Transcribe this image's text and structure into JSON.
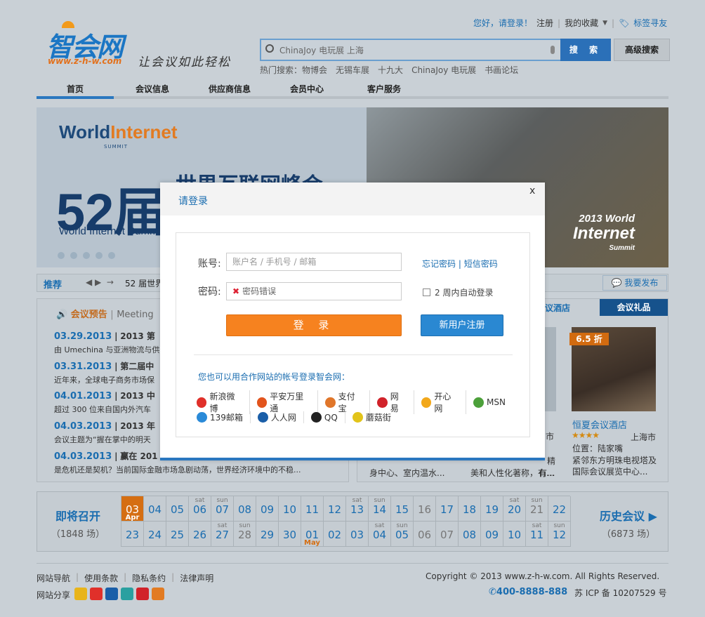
{
  "header": {
    "logo_text": "智会网",
    "logo_url": "www.z-h-w.com",
    "slogan": "让会议如此轻松",
    "greeting": "您好，请登录！",
    "register": "注册",
    "favorites": "我的收藏",
    "bookmark": "标签寻友"
  },
  "search": {
    "placeholder": "ChinaJoy 电玩展 上海",
    "button": "搜 索",
    "advanced": "高级搜索",
    "hot_label": "热门搜索：",
    "hot_items": [
      "物博会",
      "无锡车展",
      "十九大",
      "ChinaJoy 电玩展",
      "书画论坛"
    ]
  },
  "nav": {
    "items": [
      "首页",
      "会议信息",
      "供应商信息",
      "会员中心",
      "客户服务"
    ]
  },
  "banner": {
    "brand_world": "World",
    "brand_internet": "Internet",
    "brand_summit": "SUMMIT",
    "number": "52届",
    "title": "世界互联网峰会",
    "subtitle": "World Internet Summit",
    "corner_line1": "2013 World",
    "corner_line2": "Internet",
    "corner_line3": "Summit"
  },
  "recommend": {
    "label": "推荐",
    "text": "52 届世界",
    "publish": "我要发布"
  },
  "preview": {
    "title": "会议预告",
    "meeting": "Meeting",
    "items": [
      {
        "date": "03.29.2013",
        "title": "2013 第",
        "summary": "由 Umechina 与亚洲物流与供"
      },
      {
        "date": "03.31.2013",
        "title": "第二届中",
        "summary": "近年来，全球电子商务市场保"
      },
      {
        "date": "04.01.2013",
        "title": "2013 中",
        "summary": "超过 300 位来自国内外汽车"
      },
      {
        "date": "04.03.2013",
        "title": "2013 年",
        "summary": "会议主题为“握在掌中的明天"
      },
      {
        "date": "04.03.2013",
        "title": "赢在 201",
        "summary": "是危机还是契机？当前国际金融市场急剧动荡，世界经济环境中的不稳..."
      }
    ]
  },
  "right_panel": {
    "tab_hotel": "议酒店",
    "tab_gift": "会议礼品",
    "partial_mid": [
      "市",
      "精",
      "有..."
    ],
    "hotel": {
      "discount": "6.5 折",
      "name": "恒夏会议酒店",
      "stars": "★★★★",
      "city": "上海市",
      "location": "位置：陆家嘴",
      "desc": "紧邻东方明珠电视塔及国际会议展览中心..."
    },
    "desc_left": "身中心、室内温水...",
    "desc_mid": "美和人性化著称，有..."
  },
  "calendar": {
    "left_title": "即将召开",
    "left_count": "（1848 场）",
    "right_title": "历史会议",
    "right_count": "（6873 场）",
    "row1": [
      {
        "d": "03",
        "m": "Apr",
        "today": true
      },
      {
        "d": "04"
      },
      {
        "d": "05"
      },
      {
        "d": "06",
        "w": "sat"
      },
      {
        "d": "07",
        "w": "sun"
      },
      {
        "d": "08"
      },
      {
        "d": "09"
      },
      {
        "d": "10"
      },
      {
        "d": "11"
      },
      {
        "d": "12"
      },
      {
        "d": "13",
        "w": "sat"
      },
      {
        "d": "14",
        "w": "sun"
      },
      {
        "d": "15"
      },
      {
        "d": "16",
        "grey": true
      },
      {
        "d": "17"
      },
      {
        "d": "18"
      },
      {
        "d": "19"
      },
      {
        "d": "20",
        "w": "sat"
      },
      {
        "d": "21",
        "w": "sun",
        "grey": true
      },
      {
        "d": "22"
      }
    ],
    "row2": [
      {
        "d": "23"
      },
      {
        "d": "24"
      },
      {
        "d": "25"
      },
      {
        "d": "26"
      },
      {
        "d": "27",
        "w": "sat"
      },
      {
        "d": "28",
        "w": "sun",
        "grey": true
      },
      {
        "d": "29"
      },
      {
        "d": "30"
      },
      {
        "d": "01",
        "m": "May"
      },
      {
        "d": "02"
      },
      {
        "d": "03"
      },
      {
        "d": "04",
        "w": "sat"
      },
      {
        "d": "05",
        "w": "sun"
      },
      {
        "d": "06",
        "grey": true
      },
      {
        "d": "07",
        "grey": true
      },
      {
        "d": "08"
      },
      {
        "d": "09"
      },
      {
        "d": "10"
      },
      {
        "d": "11",
        "w": "sat"
      },
      {
        "d": "12",
        "w": "sun"
      }
    ]
  },
  "footer": {
    "links": [
      "网站导航",
      "使用条款",
      "隐私条约",
      "法律声明"
    ],
    "share": "网站分享",
    "copyright": "Copyright © 2013 www.z-h-w.com. All Rights Reserved.",
    "phone": "400-8888-888",
    "icp": "苏 ICP 备 10207529 号"
  },
  "login": {
    "title": "请登录",
    "close": "x",
    "account_label": "账号:",
    "account_placeholder": "账户名 / 手机号 / 邮箱",
    "password_label": "密码:",
    "password_error": "密码错误",
    "forgot": "忘记密码",
    "sms": "短信密码",
    "remember": "2 周内自动登录",
    "login_button": "登 录",
    "register_button": "新用户注册",
    "partner_title": "您也可以用合作网站的帐号登录智会网：",
    "partners_row1": [
      {
        "name": "新浪微博",
        "icon": "weibo-icon",
        "color": "#e0302a"
      },
      {
        "name": "平安万里通",
        "icon": "pingan-icon",
        "color": "#e2541d"
      },
      {
        "name": "支付宝",
        "icon": "alipay-icon",
        "color": "#e0762a"
      },
      {
        "name": "网易",
        "icon": "netease-icon",
        "color": "#d1222a"
      },
      {
        "name": "开心网",
        "icon": "kaixin-icon",
        "color": "#f2a81b"
      },
      {
        "name": "MSN",
        "icon": "msn-icon",
        "color": "#4ca03a"
      }
    ],
    "partners_row2": [
      {
        "name": "139邮箱",
        "icon": "mail139-icon",
        "color": "#2a8ad8"
      },
      {
        "name": "人人网",
        "icon": "renren-icon",
        "color": "#1a5ea8"
      },
      {
        "name": "QQ",
        "icon": "qq-icon",
        "color": "#222222"
      },
      {
        "name": "蘑菇街",
        "icon": "mogujie-icon",
        "color": "#e2c41a"
      }
    ]
  }
}
